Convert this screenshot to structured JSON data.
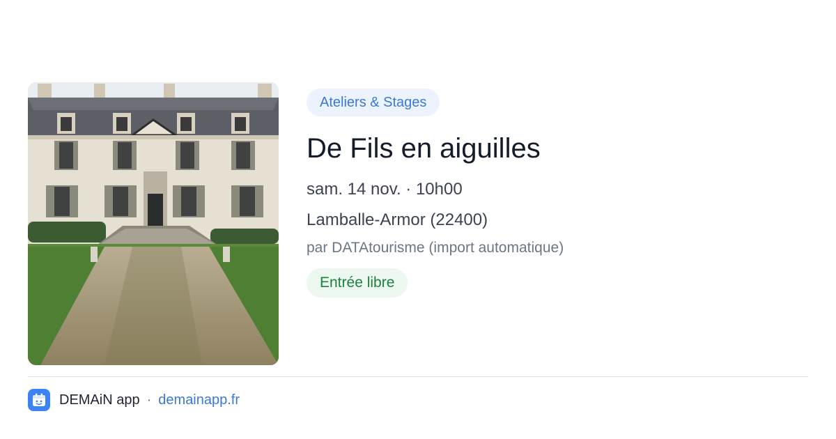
{
  "event": {
    "image_alt": "Château en pierre avec allée de gravier",
    "category": "Ateliers & Stages",
    "title": "De Fils en aiguilles",
    "datetime": "sam. 14 nov. · 10h00",
    "location": "Lamballe-Armor (22400)",
    "source": "par DATAtourisme (import automatique)",
    "price": "Entrée libre"
  },
  "footer": {
    "app_name": "DEMAiN app",
    "separator": "·",
    "url": "demainapp.fr"
  },
  "colors": {
    "accent": "#3a79d6",
    "category_bg": "#edf3fd",
    "price_text": "#1f7f3e",
    "price_bg": "#ecf8ef"
  }
}
